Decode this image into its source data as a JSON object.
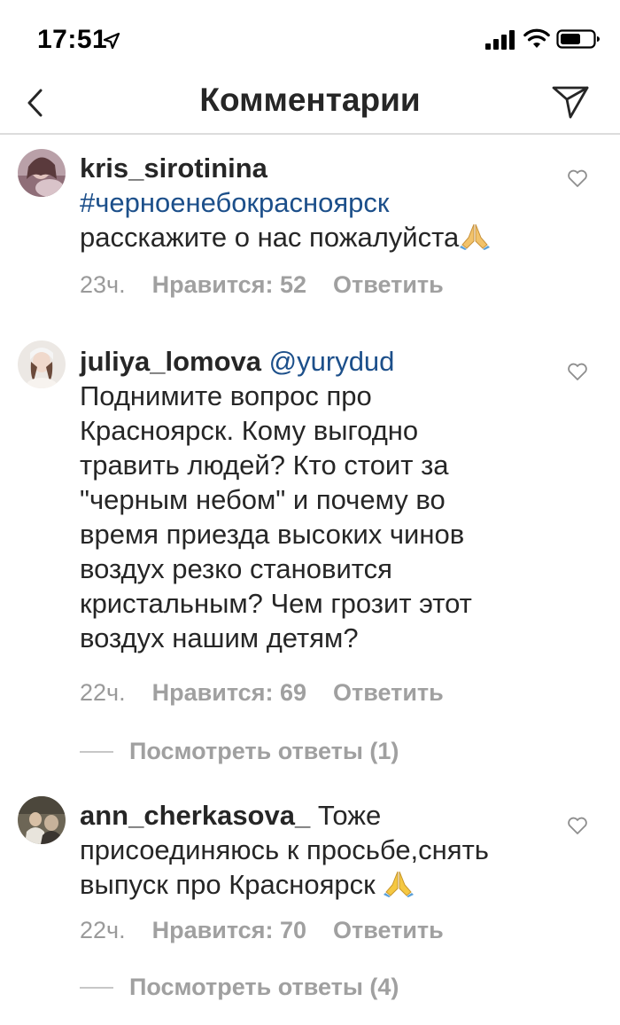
{
  "status_bar": {
    "time": "17:51"
  },
  "nav": {
    "title": "Комментарии"
  },
  "comments": [
    {
      "username": "kris_sirotinina",
      "hashtag": "#черноенебокрасноярск",
      "text": "расскажите о нас пожалуйста",
      "time": "23ч.",
      "likes": "Нравится: 52",
      "reply": "Ответить"
    },
    {
      "username": "juliya_lomova",
      "mention": "@yurydud",
      "lines": [
        "Поднимите вопрос про",
        "Красноярск. Кому выгодно",
        "травить людей? Кто стоит за",
        "\"черным небом\" и почему во",
        "время приезда высоких чинов",
        "воздух резко становится",
        "кристальным? Чем грозит этот",
        "воздух нашим детям?"
      ],
      "time": "22ч.",
      "likes": "Нравится: 69",
      "reply": "Ответить",
      "view_replies": "Посмотреть ответы (1)"
    },
    {
      "username": "ann_cherkasova_",
      "text_first": "Тоже",
      "lines": [
        "присоединяюсь к просьбе,снять",
        "выпуск про Красноярск"
      ],
      "time": "22ч.",
      "likes": "Нравится: 70",
      "reply": "Ответить",
      "view_replies": "Посмотреть ответы (4)"
    }
  ],
  "icons": {
    "back": "chevron-left-icon",
    "share": "paper-plane-icon",
    "like": "heart-icon",
    "emoji": "folded-hands-emoji"
  },
  "colors": {
    "link": "#1c4f8a",
    "meta": "#9a9a9a"
  }
}
